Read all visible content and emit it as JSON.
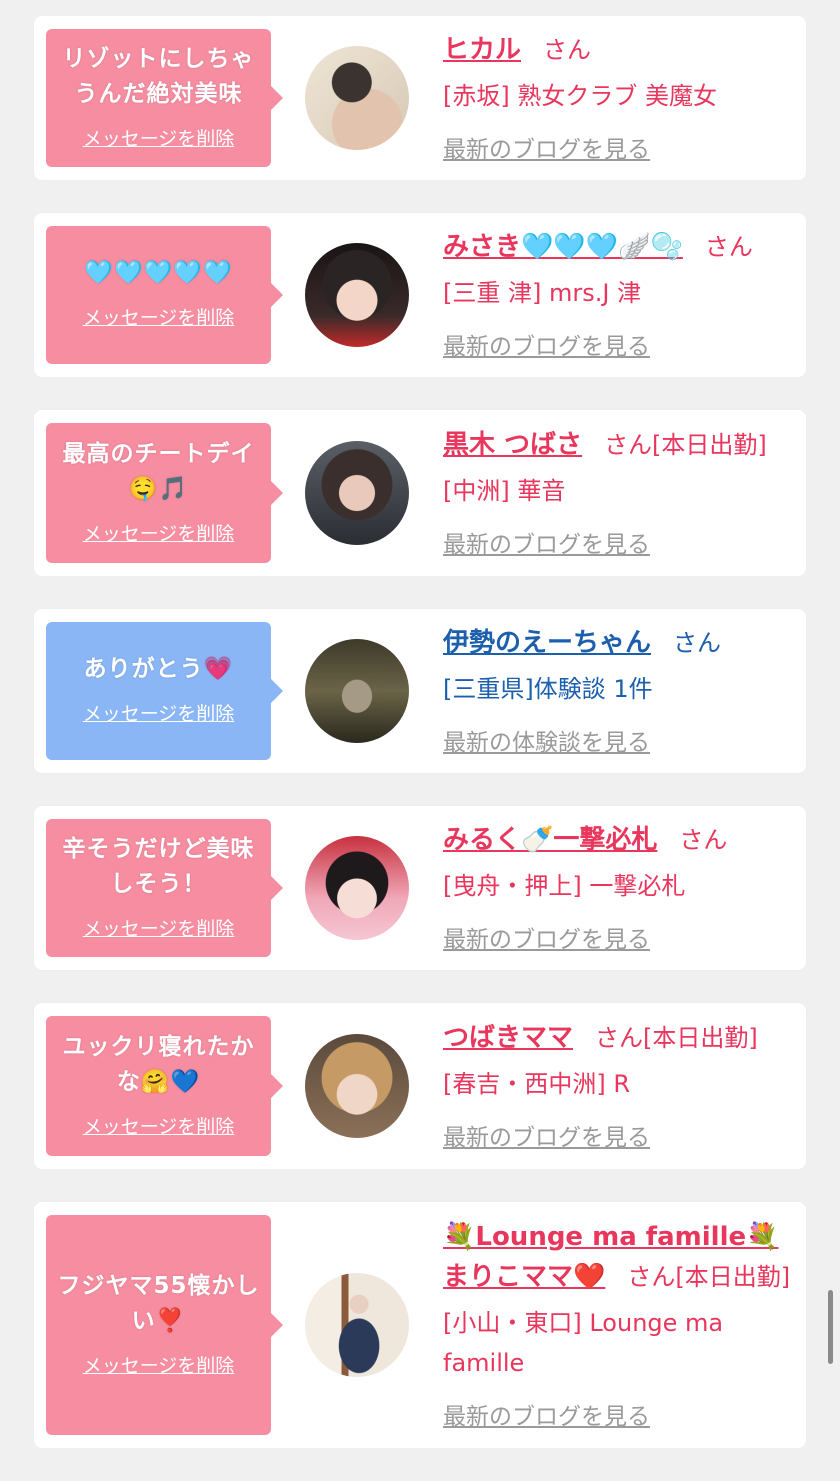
{
  "colors": {
    "pink": "#f68da1",
    "blue": "#8ab6f5",
    "pink_text": "#e8365d",
    "blue_text": "#1c5fad",
    "link_gray": "#9a9a9a"
  },
  "messages": [
    {
      "bubble_text": "リゾットにしちゃうんだ絶対美味",
      "delete_label": "メッセージを削除",
      "name": "ヒカル",
      "san": "さん",
      "shop": "[赤坂] 熟女クラブ 美魔女",
      "more": "最新のブログを見る",
      "theme": "pink",
      "avatar_icon": "woman-back-photo"
    },
    {
      "bubble_text": "🩵🩵🩵🩵🩵",
      "delete_label": "メッセージを削除",
      "name": "みさき🩵🩵🩵🪽🫧",
      "san": "さん",
      "shop": "[三重 津] mrs.J 津",
      "more": "最新のブログを見る",
      "theme": "pink",
      "avatar_icon": "cat-ears-photo"
    },
    {
      "bubble_text": "最高のチートデイ🤤🎵",
      "delete_label": "メッセージを削除",
      "name": "黒木 つばさ",
      "san": "さん[本日出勤]",
      "shop": "[中洲] 華音",
      "more": "最新のブログを見る",
      "theme": "pink",
      "avatar_icon": "portrait-photo"
    },
    {
      "bubble_text": "ありがとう💗",
      "delete_label": "メッセージを削除",
      "name": "伊勢のえーちゃん",
      "san": "さん",
      "shop": "[三重県]体験談 1件",
      "more": "最新の体験談を見る",
      "theme": "blue",
      "avatar_icon": "statue-photo"
    },
    {
      "bubble_text": "辛そうだけど美味しそう！",
      "delete_label": "メッセージを削除",
      "name": "みるく🍼一撃必札",
      "san": "さん",
      "shop": "[曳舟・押上] 一撃必札",
      "more": "最新のブログを見る",
      "theme": "pink",
      "avatar_icon": "red-bow-photo"
    },
    {
      "bubble_text": "ユックリ寝れたかな🤗💙",
      "delete_label": "メッセージを削除",
      "name": "つばきママ",
      "san": "さん[本日出勤]",
      "shop": "[春吉・西中洲] R",
      "more": "最新のブログを見る",
      "theme": "pink",
      "avatar_icon": "blonde-photo"
    },
    {
      "bubble_text": "フジヤマ55懐かしい❣️",
      "delete_label": "メッセージを削除",
      "name": "💐Lounge ma famille💐まりこママ❤️",
      "san": "さん[本日出勤]",
      "shop": "[小山・東口] Lounge ma famille",
      "more": "最新のブログを見る",
      "theme": "pink",
      "avatar_icon": "kimono-photo"
    }
  ]
}
